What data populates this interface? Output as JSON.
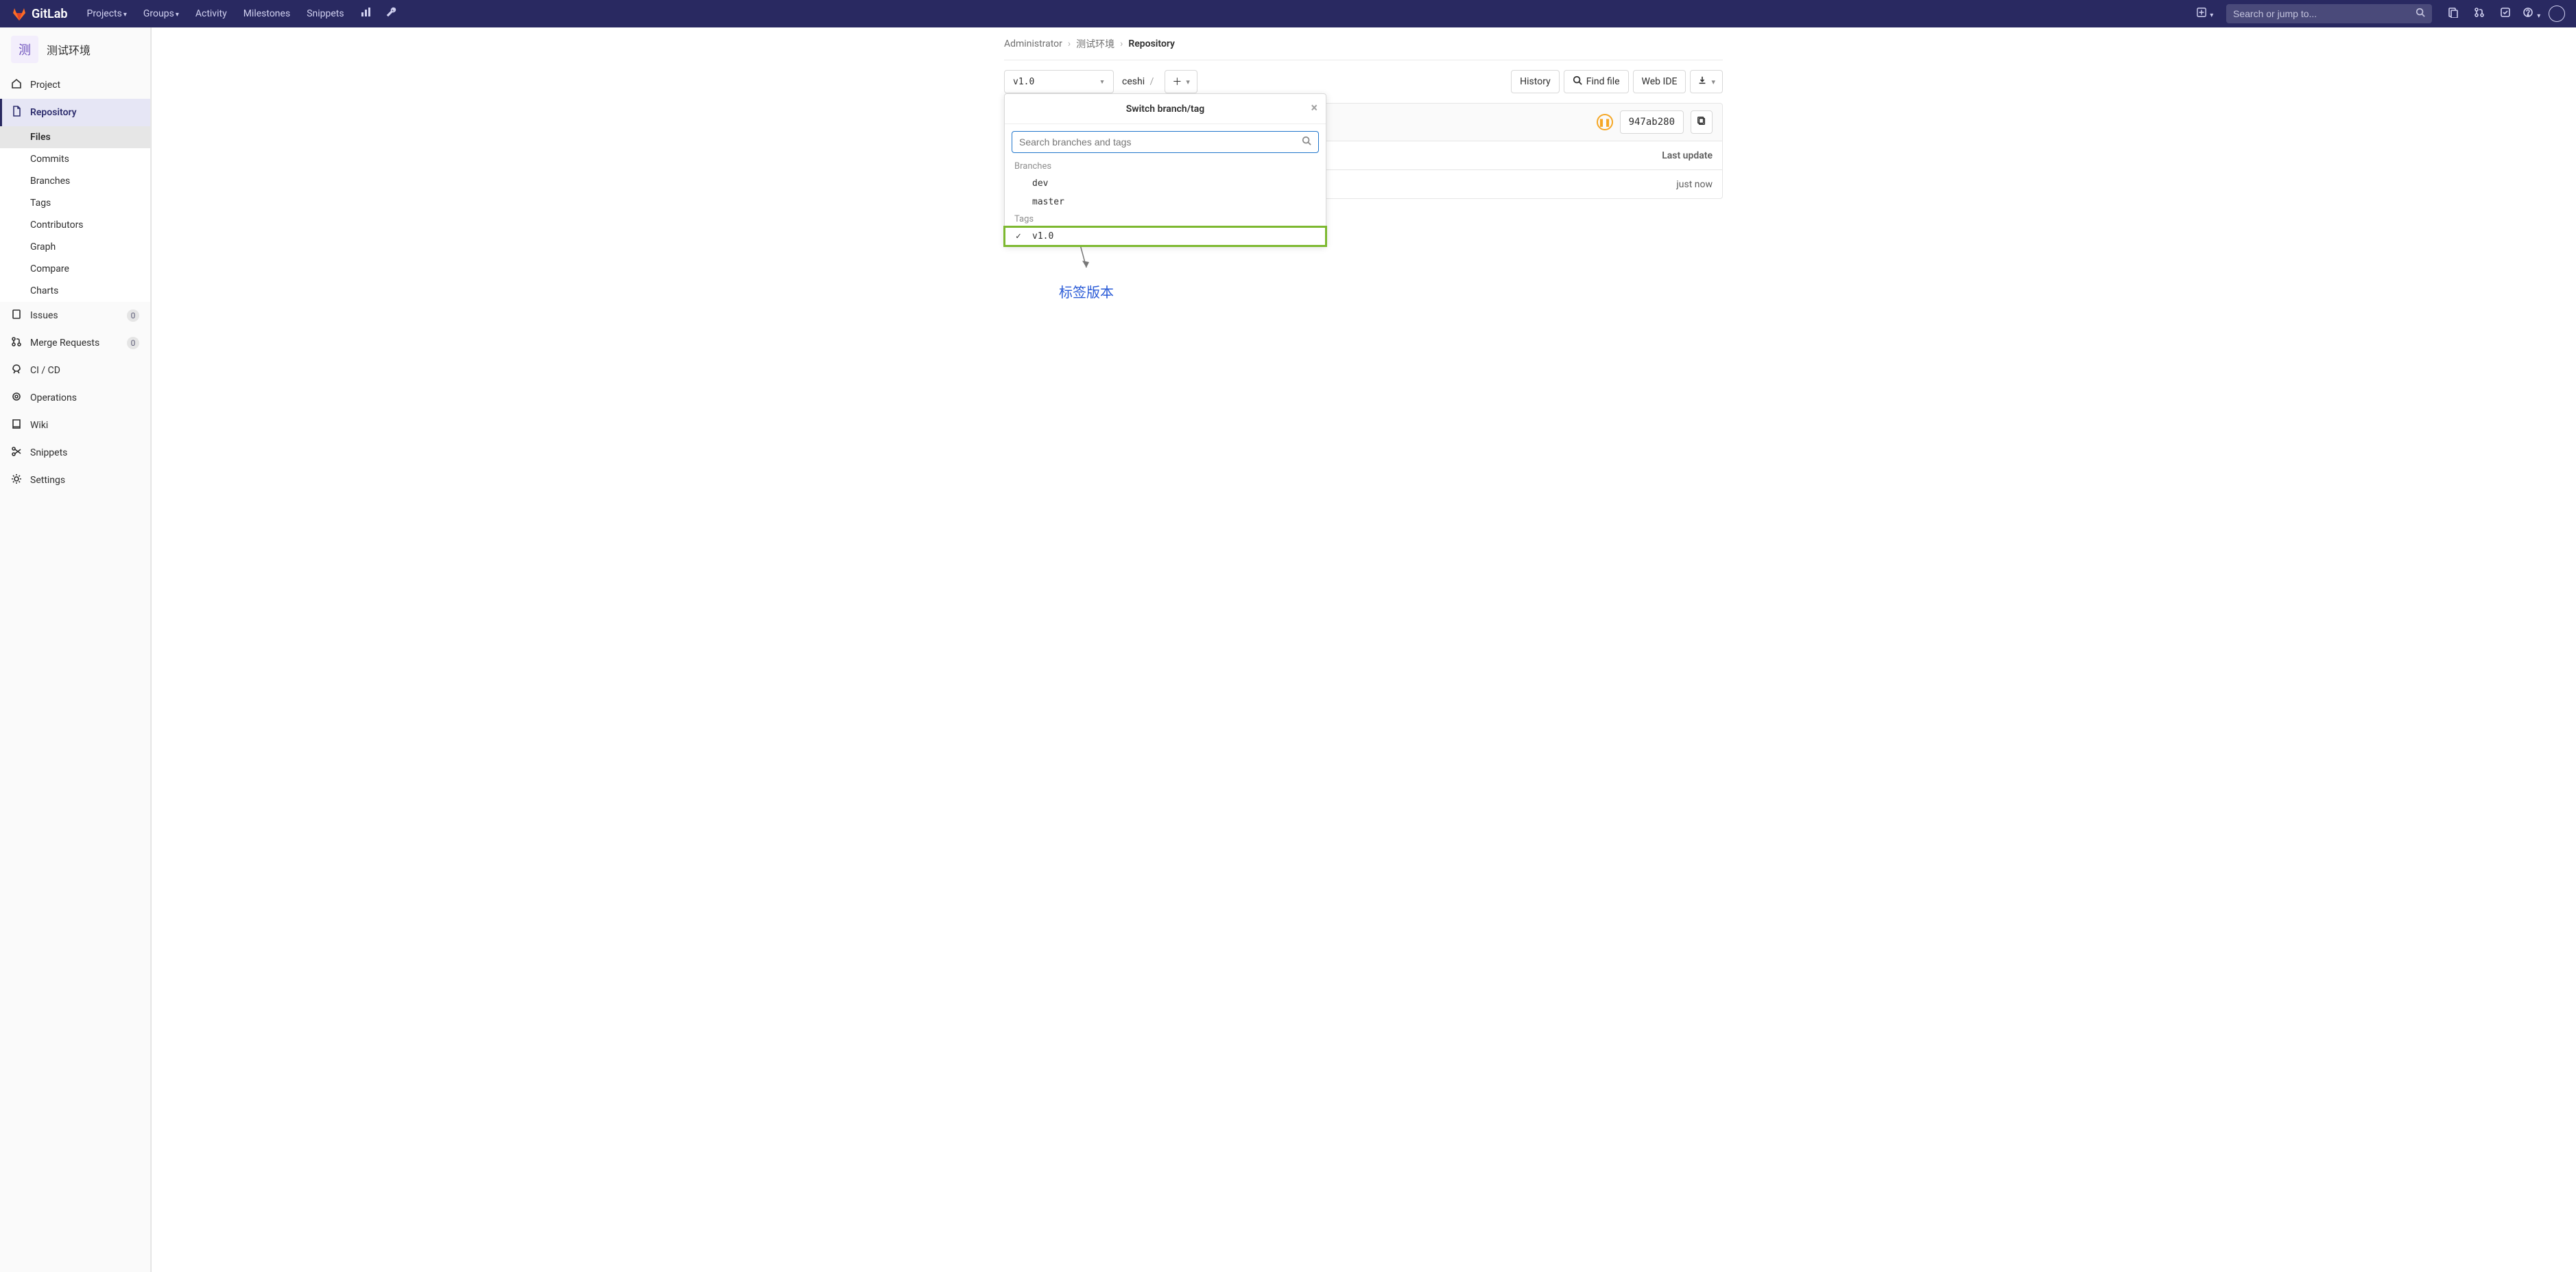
{
  "brand": "GitLab",
  "nav": {
    "projects": "Projects",
    "groups": "Groups",
    "activity": "Activity",
    "milestones": "Milestones",
    "snippets": "Snippets"
  },
  "search_placeholder": "Search or jump to...",
  "sidebar": {
    "project_avatar": "测",
    "project_name": "测试环境",
    "items": {
      "project": "Project",
      "repository": "Repository",
      "issues": "Issues",
      "issues_count": "0",
      "merge_requests": "Merge Requests",
      "mr_count": "0",
      "cicd": "CI / CD",
      "operations": "Operations",
      "wiki": "Wiki",
      "snippets": "Snippets",
      "settings": "Settings"
    },
    "repo_sub": {
      "files": "Files",
      "commits": "Commits",
      "branches": "Branches",
      "tags": "Tags",
      "contributors": "Contributors",
      "graph": "Graph",
      "compare": "Compare",
      "charts": "Charts"
    }
  },
  "breadcrumb": {
    "owner": "Administrator",
    "project": "测试环境",
    "page": "Repository"
  },
  "toolbar": {
    "ref": "v1.0",
    "path": "ceshi",
    "history": "History",
    "find_file": "Find file",
    "web_ide": "Web IDE"
  },
  "commit": {
    "sha": "947ab280"
  },
  "table": {
    "last_update_header": "Last update",
    "row_time": "just now"
  },
  "dropdown": {
    "title": "Switch branch/tag",
    "search_placeholder": "Search branches and tags",
    "branches_label": "Branches",
    "tags_label": "Tags",
    "branches": [
      "dev",
      "master"
    ],
    "tags": [
      "v1.0"
    ]
  },
  "annotation": "标签版本"
}
